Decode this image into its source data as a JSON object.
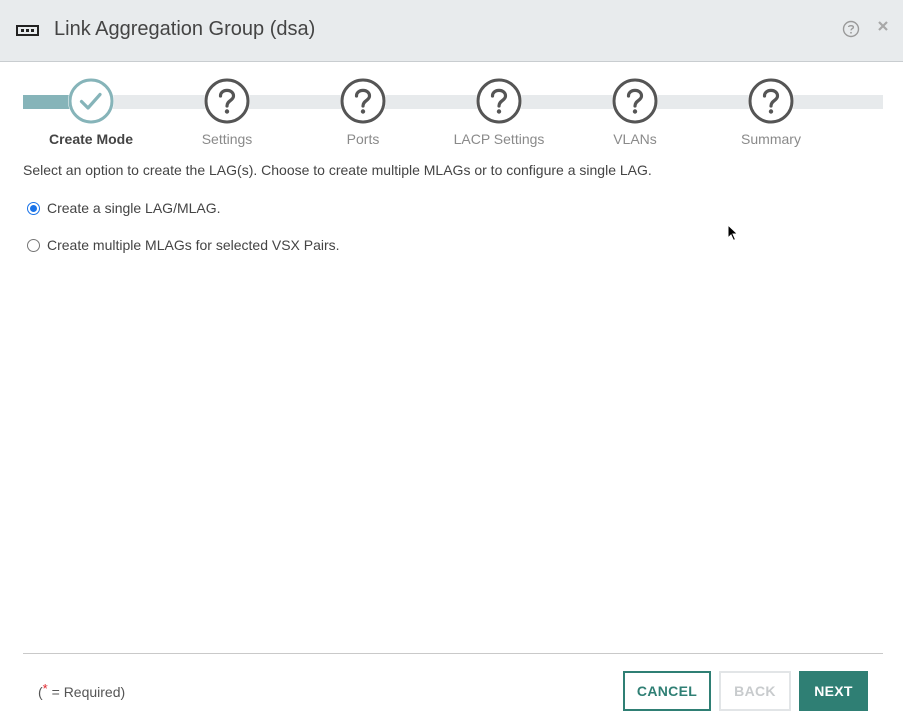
{
  "header": {
    "title": "Link Aggregation Group (dsa)",
    "icons": [
      "lag-icon",
      "help-icon",
      "close-icon"
    ]
  },
  "stepper": {
    "progress": 0.05,
    "steps": [
      {
        "label": "Create Mode",
        "state": "completed",
        "icon": "check-icon"
      },
      {
        "label": "Settings",
        "state": "pending",
        "icon": "question-icon"
      },
      {
        "label": "Ports",
        "state": "pending",
        "icon": "question-icon"
      },
      {
        "label": "LACP Settings",
        "state": "pending",
        "icon": "question-icon"
      },
      {
        "label": "VLANs",
        "state": "pending",
        "icon": "question-icon"
      },
      {
        "label": "Summary",
        "state": "pending",
        "icon": "question-icon"
      }
    ]
  },
  "main": {
    "intro": "Select an option to create the LAG(s). Choose to create multiple MLAGs or to configure a single LAG.",
    "options": [
      {
        "label": "Create a single LAG/MLAG.",
        "selected": true
      },
      {
        "label": "Create multiple MLAGs for selected VSX Pairs.",
        "selected": false
      }
    ]
  },
  "footer": {
    "required_open": "(",
    "required_star": "*",
    "required_text": " = Required)",
    "cancel_label": "CANCEL",
    "back_label": "BACK",
    "next_label": "NEXT"
  },
  "colors": {
    "accent": "#2f7f74",
    "progress_fill": "#86b4b9",
    "header_bg": "#e8ebed",
    "required_star": "#e0242b",
    "radio_selected": "#1a73e8"
  }
}
